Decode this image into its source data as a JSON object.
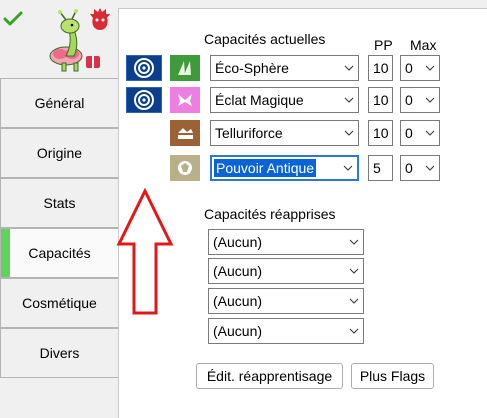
{
  "header": {
    "status_icon": "check-icon",
    "shiny_icon": "shiny-icon",
    "sprite": "meganium-sprite"
  },
  "sidebar": {
    "items": [
      {
        "label": "Général"
      },
      {
        "label": "Origine"
      },
      {
        "label": "Stats"
      },
      {
        "label": "Capacités",
        "active": true,
        "accent_color": "#5fd25f"
      },
      {
        "label": "Cosmétique"
      },
      {
        "label": "Divers"
      }
    ]
  },
  "moves": {
    "current_label": "Capacités actuelles",
    "pp_label": "PP",
    "max_label": "Max",
    "rows": [
      {
        "type_badge": "pokeball-icon",
        "category_icon": "grass-type-icon",
        "name": "Éco-Sphère",
        "pp": "10",
        "max": "0"
      },
      {
        "type_badge": "pokeball-icon",
        "category_icon": "fairy-type-icon",
        "name": "Éclat Magique",
        "pp": "10",
        "max": "0"
      },
      {
        "type_badge": "",
        "category_icon": "ground-type-icon",
        "name": "Telluriforce",
        "pp": "10",
        "max": "0"
      },
      {
        "type_badge": "",
        "category_icon": "rock-type-icon",
        "name": "Pouvoir Antique",
        "pp": "5",
        "max": "0",
        "selected": true
      }
    ]
  },
  "relearn": {
    "label": "Capacités réapprises",
    "options": [
      "(Aucun)",
      "(Aucun)",
      "(Aucun)",
      "(Aucun)"
    ]
  },
  "buttons": {
    "relearn_edit": "Édit. réapprentisage",
    "plus_flags": "Plus Flags"
  },
  "colors": {
    "accent_tab": "#5fd25f",
    "selection": "#0a64d6",
    "annotation_arrow": "#e01818",
    "type_badge_bg": "#0b3f8c"
  }
}
